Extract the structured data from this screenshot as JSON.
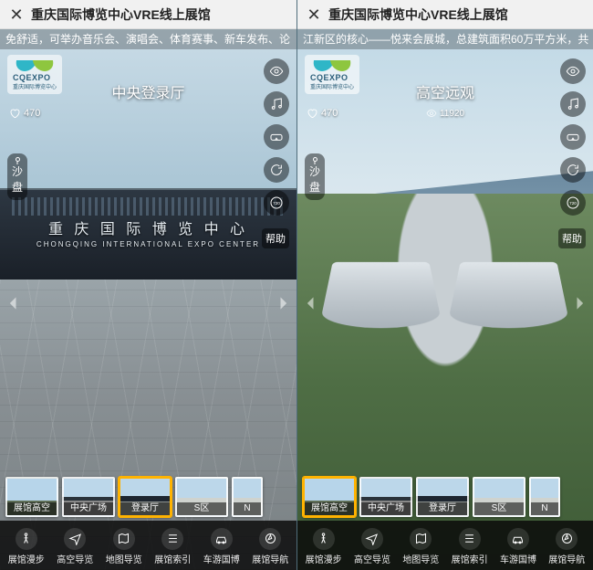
{
  "panes": [
    {
      "header_title": "重庆国际博览中心VRE线上展馆",
      "marquee": "免舒适，可举办音乐会、演唱会、体育赛事、新车发布、论",
      "logo": {
        "brand": "CQEXPO",
        "sub": "重庆国际博览中心"
      },
      "location_title": "中央登录厅",
      "likes": "470",
      "views": "",
      "building_cn": "重 庆 国 际 博 览 中 心",
      "building_en": "CHONGQING INTERNATIONAL EXPO CENTER",
      "chip": "沙盘",
      "help": "帮助",
      "thumbs": [
        {
          "label": "展馆高空",
          "variant": "v1",
          "active": false
        },
        {
          "label": "中央广场",
          "variant": "v2",
          "active": false
        },
        {
          "label": "登录厅",
          "variant": "v3",
          "active": true
        },
        {
          "label": "S区",
          "variant": "v4",
          "active": false
        },
        {
          "label": "N",
          "variant": "v4",
          "active": false
        }
      ],
      "toolbar": [
        "展馆漫步",
        "高空导览",
        "地图导览",
        "展馆索引",
        "车游国博",
        "展馆导航"
      ]
    },
    {
      "header_title": "重庆国际博览中心VRE线上展馆",
      "marquee": "江新区的核心——悦来会展城，总建筑面积60万平方米，共",
      "logo": {
        "brand": "CQEXPO",
        "sub": "重庆国际博览中心"
      },
      "location_title": "高空远观",
      "likes": "470",
      "views": "11920",
      "building_cn": "",
      "building_en": "",
      "chip": "沙盘",
      "help": "帮助",
      "thumbs": [
        {
          "label": "展馆高空",
          "variant": "v1",
          "active": true
        },
        {
          "label": "中央广场",
          "variant": "v2",
          "active": false
        },
        {
          "label": "登录厅",
          "variant": "v3",
          "active": false
        },
        {
          "label": "S区",
          "variant": "v4",
          "active": false
        },
        {
          "label": "N",
          "variant": "v4",
          "active": false
        }
      ],
      "toolbar": [
        "展馆漫步",
        "高空导览",
        "地图导览",
        "展馆索引",
        "车游国博",
        "展馆导航"
      ]
    }
  ],
  "icons": {
    "eye": "eye-icon",
    "music": "music-icon",
    "vr": "vr-icon",
    "rotate": "rotate-icon",
    "hd": "hd-icon",
    "heart": "heart-icon",
    "close": "close-icon",
    "dots": "more-icon",
    "walk": "walk-icon",
    "plane": "plane-icon",
    "map": "map-icon",
    "list": "list-icon",
    "car": "car-icon",
    "nav": "nav-icon"
  }
}
